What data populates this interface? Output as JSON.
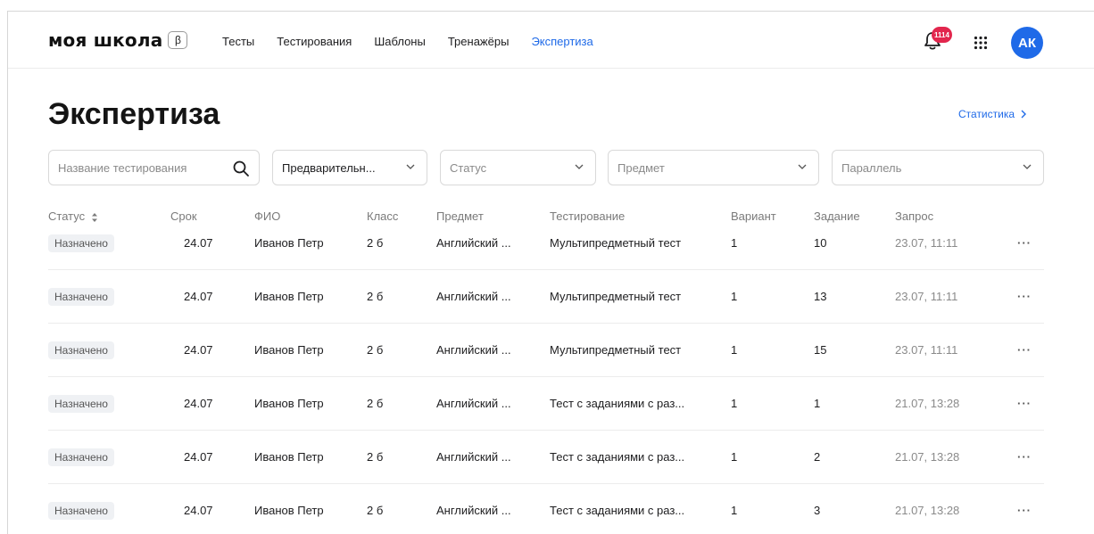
{
  "header": {
    "logo": "моя школа",
    "beta": "β",
    "nav": [
      "Тесты",
      "Тестирования",
      "Шаблоны",
      "Тренажёры",
      "Экспертиза"
    ],
    "active_nav": "Экспертиза",
    "notifications": "1114",
    "avatar": "АК",
    "accent": "#1f6ae8",
    "badge_color": "#e2264d"
  },
  "page": {
    "title": "Экспертиза",
    "stats_link": "Статистика"
  },
  "filters": {
    "search_placeholder": "Название тестирования",
    "type_value": "Предварительн...",
    "status_placeholder": "Статус",
    "subject_placeholder": "Предмет",
    "grade_placeholder": "Параллель"
  },
  "table": {
    "columns": [
      "Статус",
      "Срок",
      "ФИО",
      "Класс",
      "Предмет",
      "Тестирование",
      "Вариант",
      "Задание",
      "Запрос"
    ],
    "rows": [
      {
        "status": "Назначено",
        "due": "24.07",
        "name": "Иванов Петр",
        "class": "2 б",
        "subject": "Английский ...",
        "test": "Мультипредметный тест",
        "variant": "1",
        "task": "10",
        "request": "23.07, 11:11"
      },
      {
        "status": "Назначено",
        "due": "24.07",
        "name": "Иванов Петр",
        "class": "2 б",
        "subject": "Английский ...",
        "test": "Мультипредметный тест",
        "variant": "1",
        "task": "13",
        "request": "23.07, 11:11"
      },
      {
        "status": "Назначено",
        "due": "24.07",
        "name": "Иванов Петр",
        "class": "2 б",
        "subject": "Английский ...",
        "test": "Мультипредметный тест",
        "variant": "1",
        "task": "15",
        "request": "23.07, 11:11"
      },
      {
        "status": "Назначено",
        "due": "24.07",
        "name": "Иванов Петр",
        "class": "2 б",
        "subject": "Английский ...",
        "test": "Тест с заданиями с раз...",
        "variant": "1",
        "task": "1",
        "request": "21.07, 13:28"
      },
      {
        "status": "Назначено",
        "due": "24.07",
        "name": "Иванов Петр",
        "class": "2 б",
        "subject": "Английский ...",
        "test": "Тест с заданиями с раз...",
        "variant": "1",
        "task": "2",
        "request": "21.07, 13:28"
      },
      {
        "status": "Назначено",
        "due": "24.07",
        "name": "Иванов Петр",
        "class": "2 б",
        "subject": "Английский ...",
        "test": "Тест с заданиями с раз...",
        "variant": "1",
        "task": "3",
        "request": "21.07, 13:28"
      }
    ],
    "more_label": "···"
  }
}
